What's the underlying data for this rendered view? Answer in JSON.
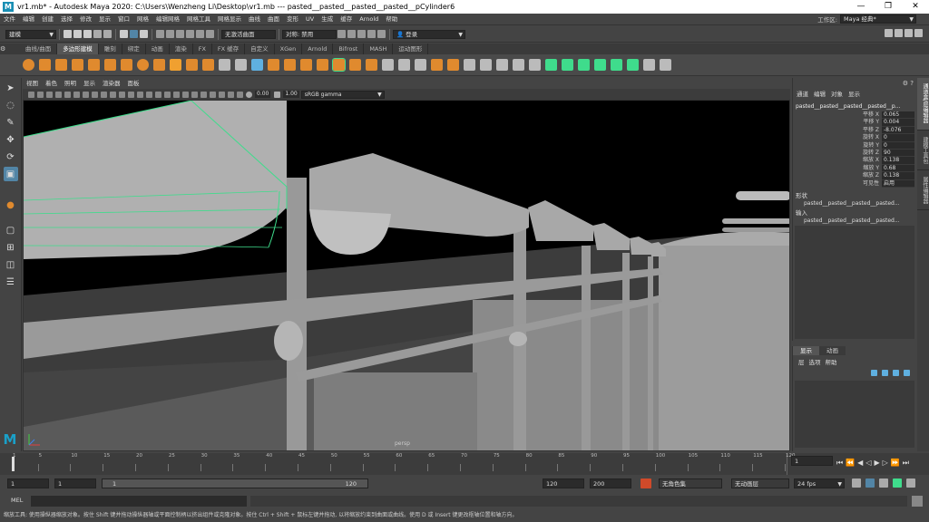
{
  "window": {
    "title": "vr1.mb* - Autodesk Maya 2020: C:\\Users\\Wenzheng Li\\Desktop\\vr1.mb   ---   pasted__pasted__pasted__pasted__pCylinder6",
    "minimize": "—",
    "restore": "❐",
    "close": "✕"
  },
  "menubar": {
    "items": [
      "文件",
      "编辑",
      "创建",
      "选择",
      "修改",
      "显示",
      "窗口",
      "网格",
      "编辑网格",
      "网格工具",
      "网格显示",
      "曲线",
      "曲面",
      "变形",
      "UV",
      "生成",
      "缓存",
      "Arnold",
      "帮助"
    ],
    "workspace_label": "工作区:",
    "workspace_value": "Maya 经典*"
  },
  "statusline": {
    "mode": "建模",
    "symmetry_label": "对称: 禁用",
    "live_surface": "无激活曲面",
    "login": "登录"
  },
  "shelf": {
    "tabs": [
      "曲线/曲面",
      "多边形建模",
      "雕刻",
      "绑定",
      "动画",
      "渲染",
      "FX",
      "FX 缓存",
      "自定义",
      "XGen",
      "Arnold",
      "Bifrost",
      "MASH",
      "运动图形"
    ],
    "active_tab": 1
  },
  "viewport": {
    "menu": [
      "视图",
      "着色",
      "照明",
      "显示",
      "渲染器",
      "面板"
    ],
    "exposure": "0.00",
    "gamma": "1.00",
    "color_space": "sRGB gamma",
    "camera": "persp"
  },
  "channelbox": {
    "menu": [
      "通道",
      "编辑",
      "对象",
      "显示"
    ],
    "object_name": "pasted__pasted__pasted__pasted__p...",
    "attributes": [
      {
        "name": "平移 X",
        "value": "0.065"
      },
      {
        "name": "平移 Y",
        "value": "0.004"
      },
      {
        "name": "平移 Z",
        "value": "-8.076"
      },
      {
        "name": "旋转 X",
        "value": "0"
      },
      {
        "name": "旋转 Y",
        "value": "0"
      },
      {
        "name": "旋转 Z",
        "value": "90"
      },
      {
        "name": "缩放 X",
        "value": "0.138"
      },
      {
        "name": "缩放 Y",
        "value": "0.68"
      },
      {
        "name": "缩放 Z",
        "value": "0.138"
      },
      {
        "name": "可见性",
        "value": "启用"
      }
    ],
    "shapes_label": "形状",
    "shape_name": "pasted__pasted__pasted__pasted...",
    "inputs_label": "输入",
    "input_name": "pasted__pasted__pasted__pasted..."
  },
  "sidetabs": [
    "通道盒/层编辑器",
    "建模工具包",
    "属性编辑器"
  ],
  "layereditor": {
    "tabs": [
      "显示",
      "动画"
    ],
    "menu": [
      "层",
      "选项",
      "帮助"
    ]
  },
  "timeslider": {
    "ticks": [
      "1",
      "5",
      "10",
      "15",
      "20",
      "25",
      "30",
      "35",
      "40",
      "45",
      "50",
      "55",
      "60",
      "65",
      "70",
      "75",
      "80",
      "85",
      "90",
      "95",
      "100",
      "105",
      "110",
      "115",
      "120"
    ],
    "current_frame": "1"
  },
  "rangeslider": {
    "start": "1",
    "playback_start": "1",
    "range_start_label": "1",
    "range_end_label": "120",
    "playback_end": "120",
    "end": "200",
    "character_set": "无角色集",
    "anim_layer": "无动画层",
    "fps": "24 fps"
  },
  "cmdline": {
    "label": "MEL"
  },
  "helpline": {
    "text": "缩放工具: 使用操纵器缩放对象。按住 Shift 键并拖动操纵器轴或平面控制柄以挤出组件或克隆对象。按住 Ctrl + Shift + 鼠标左键并拖动, 以将缩放约束到曲面或曲线。使用 D 或 Insert 键更改枢轴位置和轴方向。"
  },
  "colors": {
    "selection_green": "#3fdc8c",
    "geometry_gray": "#8e8e8e",
    "active_blue": "#5285a6",
    "maya_logo": "#1a8fb4"
  }
}
